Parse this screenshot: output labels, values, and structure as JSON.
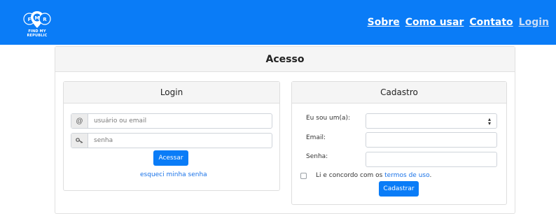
{
  "navbar": {
    "logo_text": "FIND MY REPUBLIC",
    "links": [
      "Sobre",
      "Como usar",
      "Contato",
      "Login"
    ]
  },
  "main": {
    "title": "Acesso"
  },
  "login": {
    "title": "Login",
    "user_placeholder": "usuário ou email",
    "user_addon": "@",
    "password_placeholder": "senha",
    "submit_label": "Acessar",
    "forgot_label": "esqueci minha senha"
  },
  "signup": {
    "title": "Cadastro",
    "type_label": "Eu sou um(a):",
    "email_label": "Email:",
    "password_label": "Senha:",
    "terms_prefix": "Li e concordo com os ",
    "terms_link": "termos de uso",
    "terms_suffix": ".",
    "submit_label": "Cadastrar"
  },
  "colors": {
    "brand": "#0a7cf7",
    "link": "#1a73e8"
  }
}
